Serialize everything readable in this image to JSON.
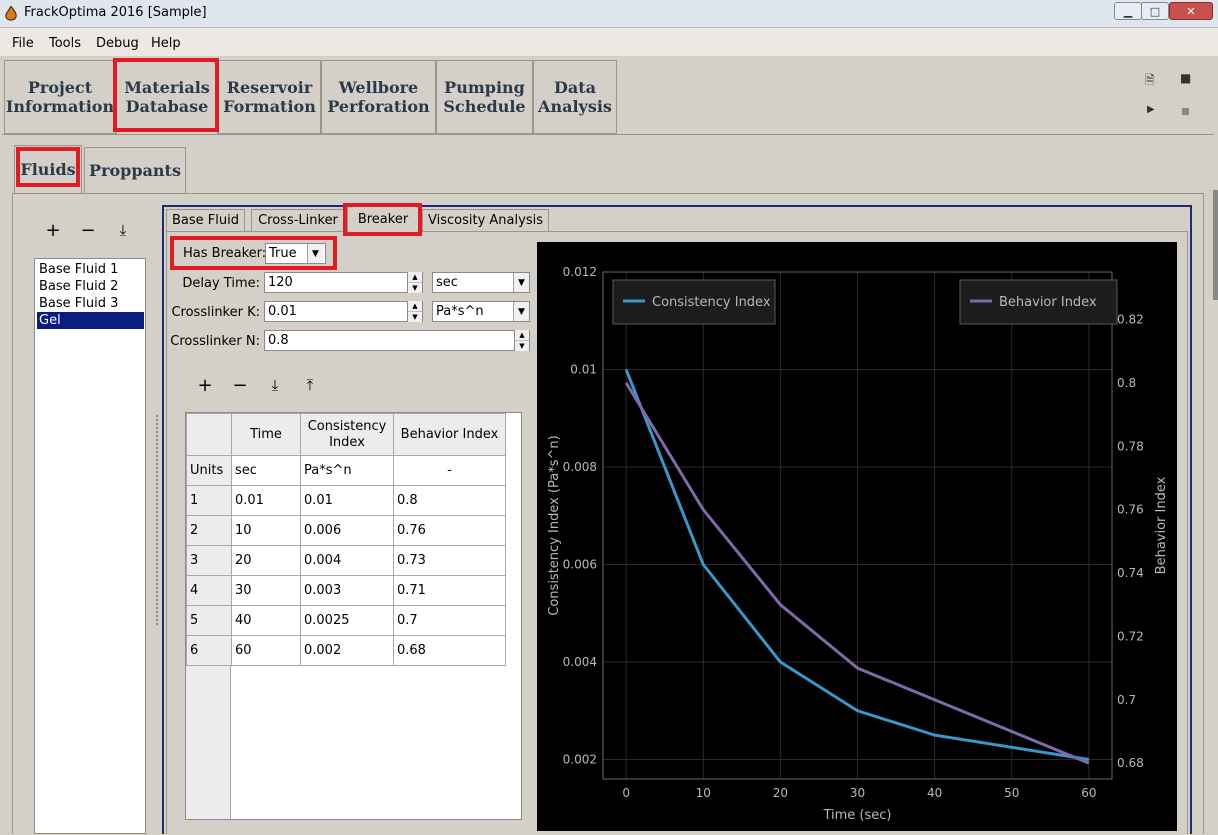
{
  "window": {
    "title": "FrackOptima 2016 [Sample]"
  },
  "menu": [
    "File",
    "Tools",
    "Debug",
    "Help"
  ],
  "main_tabs": [
    {
      "label": "Project\nInformation"
    },
    {
      "label": "Materials\nDatabase"
    },
    {
      "label": "Reservoir\nFormation"
    },
    {
      "label": "Wellbore\nPerforation"
    },
    {
      "label": "Pumping\nSchedule"
    },
    {
      "label": "Data\nAnalysis"
    }
  ],
  "material_tabs": [
    "Fluids",
    "Proppants"
  ],
  "fluid_list": {
    "items": [
      "Base Fluid 1",
      "Base Fluid 2",
      "Base Fluid 3",
      "Gel"
    ],
    "selected": "Gel"
  },
  "fluid_tabs": [
    "Base Fluid",
    "Cross-Linker",
    "Breaker",
    "Viscosity Analysis"
  ],
  "breaker": {
    "has_breaker_label": "Has Breaker:",
    "has_breaker_value": "True",
    "delay_time_label": "Delay Time:",
    "delay_time_value": "120",
    "delay_time_unit": "sec",
    "crosslinker_k_label": "Crosslinker K:",
    "crosslinker_k_value": "0.01",
    "crosslinker_k_unit": "Pa*s^n",
    "crosslinker_n_label": "Crosslinker N:",
    "crosslinker_n_value": "0.8"
  },
  "table": {
    "headers": [
      "Time",
      "Consistency\nIndex",
      "Behavior Index"
    ],
    "units_label": "Units",
    "units": [
      "sec",
      "Pa*s^n",
      "-"
    ],
    "rows": [
      [
        "1",
        "0.01",
        "0.01",
        "0.8"
      ],
      [
        "2",
        "10",
        "0.006",
        "0.76"
      ],
      [
        "3",
        "20",
        "0.004",
        "0.73"
      ],
      [
        "4",
        "30",
        "0.003",
        "0.71"
      ],
      [
        "5",
        "40",
        "0.0025",
        "0.7"
      ],
      [
        "6",
        "60",
        "0.002",
        "0.68"
      ]
    ]
  },
  "chart_data": {
    "type": "line",
    "x": [
      0,
      10,
      20,
      30,
      40,
      60
    ],
    "xlabel": "Time (sec)",
    "xlim": [
      -3,
      63
    ],
    "xticks": [
      "0",
      "10",
      "20",
      "30",
      "40",
      "50",
      "60"
    ],
    "series": [
      {
        "name": "Consistency Index",
        "axis": "left",
        "color": "#3a97c9",
        "values": [
          0.01,
          0.006,
          0.004,
          0.003,
          0.0025,
          0.002
        ]
      },
      {
        "name": "Behavior Index",
        "axis": "right",
        "color": "#8069a8",
        "values": [
          0.8,
          0.76,
          0.73,
          0.71,
          0.7,
          0.68
        ]
      }
    ],
    "ylabel_left": "Consistency Index (Pa*s^n)",
    "ylim_left": [
      0.0016,
      0.012
    ],
    "yticks_left": [
      "0.002",
      "0.004",
      "0.006",
      "0.008",
      "0.01",
      "0.012"
    ],
    "ylabel_right": "Behavior Index",
    "ylim_right": [
      0.675,
      0.835
    ],
    "yticks_right": [
      "0.68",
      "0.7",
      "0.72",
      "0.74",
      "0.76",
      "0.78",
      "0.8",
      "0.82"
    ],
    "grid": true,
    "background": "#000000"
  }
}
